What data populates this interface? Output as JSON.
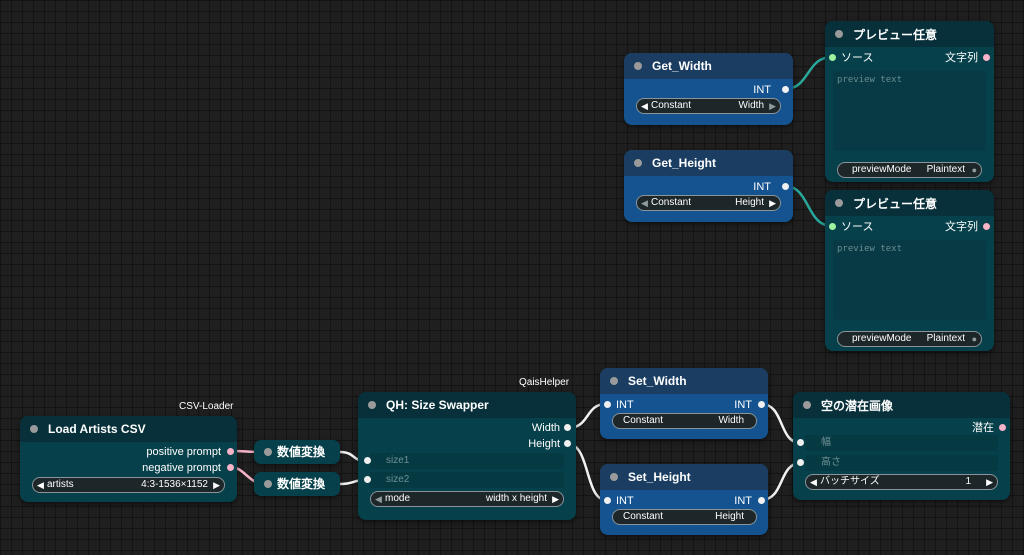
{
  "colors": {
    "canvas": "#1f1f1f",
    "node_teal": "#06404a",
    "node_blue": "#14538f",
    "wire_teal": "#28a79b",
    "wire_white": "#f2f2f2",
    "dot_pink": "#f7b4c8",
    "dot_green": "#9ef3a0"
  },
  "load_artists": {
    "group": "CSV-Loader",
    "title": "Load Artists CSV",
    "out_positive": "positive prompt",
    "out_negative": "negative prompt",
    "widget_label": "artists",
    "widget_value": "4:3-1536×1152"
  },
  "convert1": {
    "title": "数値変換"
  },
  "convert2": {
    "title": "数値変換"
  },
  "swapper": {
    "group": "QaisHelper",
    "title": "QH: Size Swapper",
    "out_width": "Width",
    "out_height": "Height",
    "in_size1": "size1",
    "in_size2": "size2",
    "widget_label": "mode",
    "widget_value": "width x height"
  },
  "set_width": {
    "title": "Set_Width",
    "in_int": "INT",
    "out_int": "INT",
    "widget_label": "Constant",
    "widget_value": "Width"
  },
  "set_height": {
    "title": "Set_Height",
    "in_int": "INT",
    "out_int": "INT",
    "widget_label": "Constant",
    "widget_value": "Height"
  },
  "latent": {
    "title": "空の潜在画像",
    "out": "潜在",
    "in_width": "幅",
    "in_height": "高さ",
    "widget_label": "バッチサイズ",
    "widget_value": "1"
  },
  "get_width": {
    "title": "Get_Width",
    "out_int": "INT",
    "widget_label": "Constant",
    "widget_value": "Width"
  },
  "get_height": {
    "title": "Get_Height",
    "out_int": "INT",
    "widget_label": "Constant",
    "widget_value": "Height"
  },
  "preview1": {
    "title": "プレビュー任意",
    "in_source": "ソース",
    "out_string": "文字列",
    "placeholder": "preview text",
    "widget_label": "previewMode",
    "widget_value": "Plaintext"
  },
  "preview2": {
    "title": "プレビュー任意",
    "in_source": "ソース",
    "out_string": "文字列",
    "placeholder": "preview text",
    "widget_label": "previewMode",
    "widget_value": "Plaintext"
  }
}
